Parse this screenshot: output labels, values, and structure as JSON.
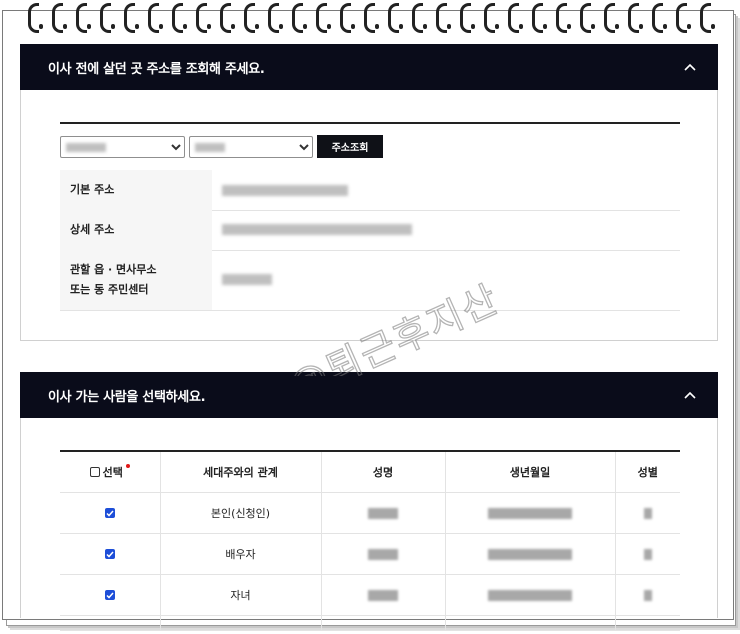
{
  "section1": {
    "title": "이사 전에 살던 곳 주소를 조회해 주세요.",
    "search_button": "주소조회",
    "rows": [
      {
        "label": "기본 주소"
      },
      {
        "label": "상세 주소"
      },
      {
        "label_line1": "관할 읍 · 면사무소",
        "label_line2": "또는 동 주민센터"
      }
    ]
  },
  "section2": {
    "title": "이사 가는 사람을 선택하세요.",
    "columns": {
      "select": "선택",
      "relation": "세대주와의 관계",
      "name": "성명",
      "birth": "생년월일",
      "gender": "성별"
    },
    "rows": [
      {
        "relation": "본인(신청인)",
        "checked": true
      },
      {
        "relation": "배우자",
        "checked": true
      },
      {
        "relation": "자녀",
        "checked": true
      }
    ]
  },
  "watermark": "@퇴근후지산",
  "colors": {
    "header_bg": "#0a0c1a",
    "checkbox": "#1d4ed8",
    "required_dot": "#e01818"
  }
}
